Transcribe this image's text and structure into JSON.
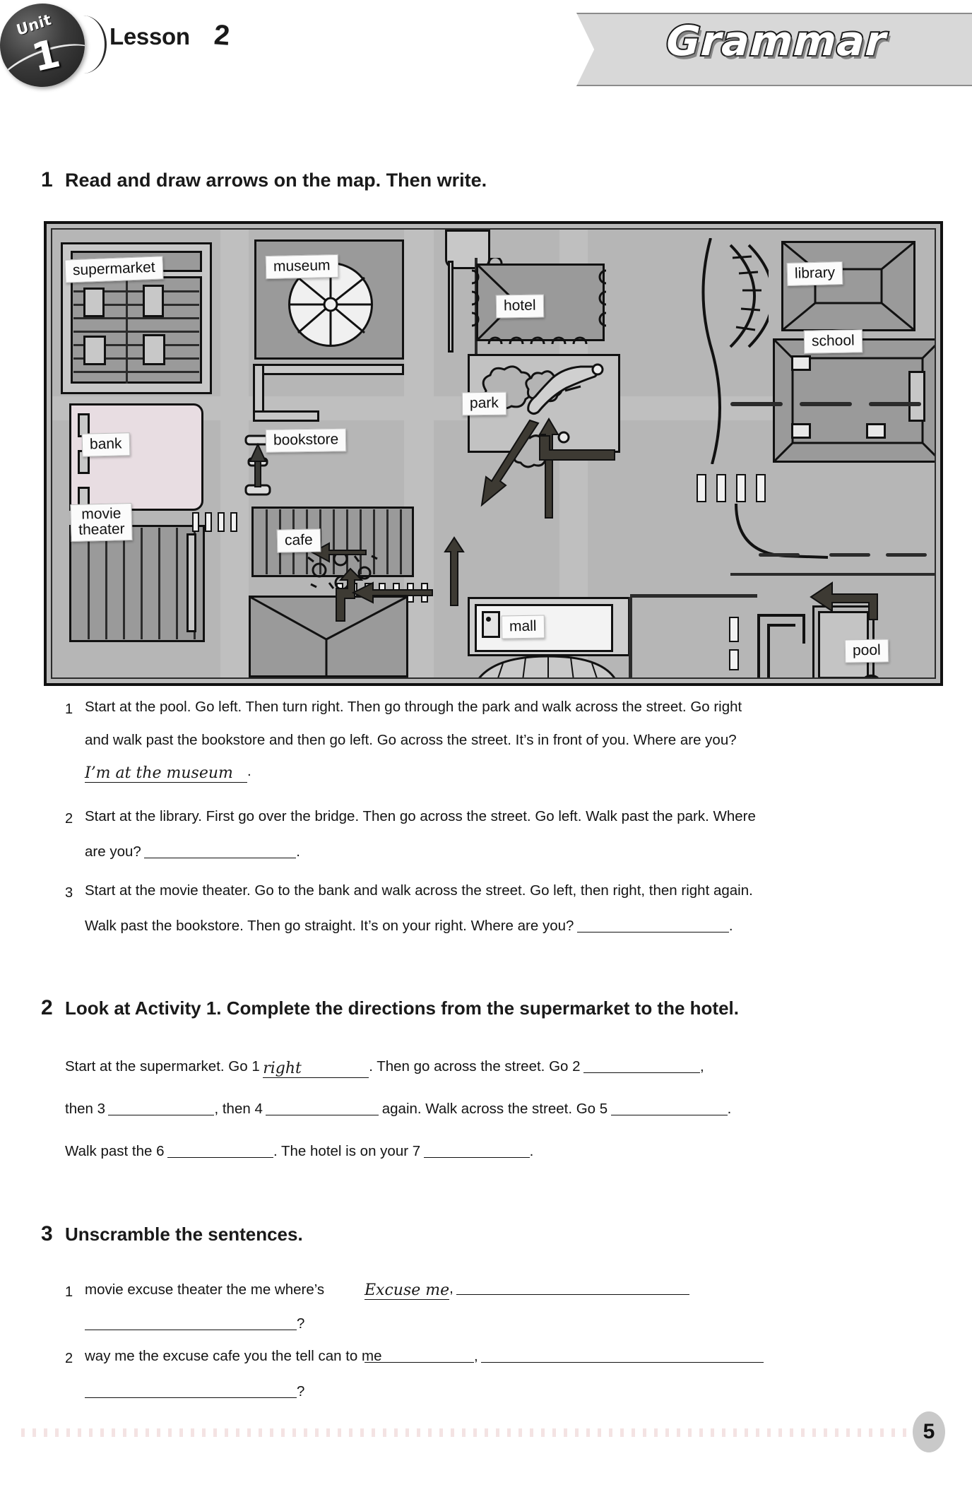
{
  "header": {
    "unit_word": "Unit",
    "unit_number": "1",
    "lesson_label": "Lesson",
    "lesson_number": "2",
    "section_banner": "Grammar"
  },
  "activity1": {
    "number": "1",
    "title": "Read and draw arrows on the map. Then write.",
    "map": {
      "labels": [
        {
          "name": "supermarket",
          "text": "supermarket"
        },
        {
          "name": "museum",
          "text": "museum"
        },
        {
          "name": "library",
          "text": "library"
        },
        {
          "name": "hotel",
          "text": "hotel"
        },
        {
          "name": "school",
          "text": "school"
        },
        {
          "name": "park",
          "text": "park"
        },
        {
          "name": "bank",
          "text": "bank"
        },
        {
          "name": "bookstore",
          "text": "bookstore"
        },
        {
          "name": "movie-theater",
          "text": "movie\ntheater"
        },
        {
          "name": "cafe",
          "text": "cafe"
        },
        {
          "name": "mall",
          "text": "mall"
        },
        {
          "name": "pool",
          "text": "pool"
        }
      ],
      "label_supermarket": "supermarket",
      "label_museum": "museum",
      "label_library": "library",
      "label_hotel": "hotel",
      "label_school": "school",
      "label_park": "park",
      "label_bank": "bank",
      "label_bookstore": "bookstore",
      "label_movie_theater_line1": "movie",
      "label_movie_theater_line2": "theater",
      "label_cafe": "cafe",
      "label_mall": "mall",
      "label_pool": "pool"
    },
    "items": [
      {
        "number": "1",
        "line1": "Start at the pool. Go left. Then turn right. Then go through the park and walk across the street. Go right",
        "line2": "and walk past the bookstore and then go left. Go across the street. It’s in front of you. Where are you?",
        "answer": "I’m at the museum",
        "answer_terminator": "."
      },
      {
        "number": "2",
        "line1": "Start at the library. First go over the bridge. Then go across the street. Go left. Walk past the park. Where",
        "line2_prefix": "are you?",
        "line2_terminator": "."
      },
      {
        "number": "3",
        "line1": "Start at the movie theater. Go to the bank and walk across the street. Go left, then right, then right again.",
        "line2_prefix": "Walk past the bookstore. Then go straight. It’s on your right. Where are you?",
        "line2_terminator": "."
      }
    ]
  },
  "activity2": {
    "number": "2",
    "title": "Look at Activity 1. Complete the directions from the supermarket to the hotel.",
    "line1_a": "Start at the supermarket. Go 1",
    "line1_answer": "right",
    "line1_b": ". Then go across the street. Go 2",
    "line1_c": ",",
    "line2_a": "then 3",
    "line2_b": ", then 4",
    "line2_c": "again. Walk across the street. Go 5",
    "line2_d": ".",
    "line3_a": "Walk past the 6",
    "line3_b": ". The hotel is on your 7",
    "line3_c": "."
  },
  "activity3": {
    "number": "3",
    "title": "Unscramble the sentences.",
    "items": [
      {
        "number": "1",
        "scrambled": "movie excuse theater the me where’s",
        "answer": "Excuse me",
        "answer_terminator": ",",
        "question_mark": "?"
      },
      {
        "number": "2",
        "scrambled": "way me the excuse cafe you the tell can to me",
        "answer": "",
        "answer_terminator": ",",
        "question_mark": "?"
      }
    ]
  },
  "footer": {
    "page_number": "5"
  }
}
